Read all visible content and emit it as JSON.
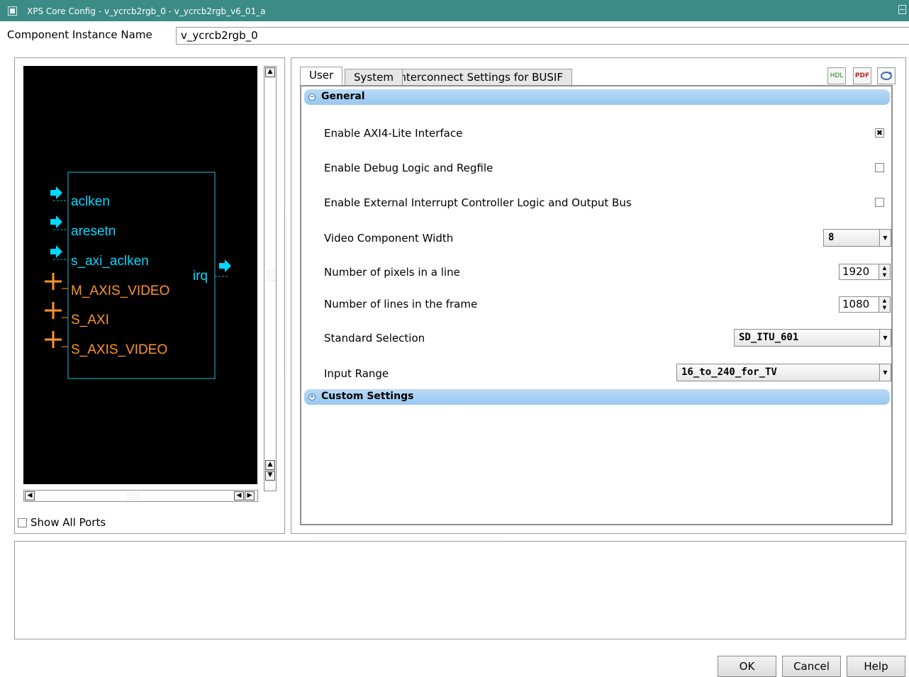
{
  "window": {
    "title": "XPS Core Config - v_ycrcb2rgb_0 - v_ycrcb2rgb_v6_01_a"
  },
  "instance": {
    "label": "Component Instance Name",
    "value": "v_ycrcb2rgb_0"
  },
  "diagram": {
    "inputs": [
      "aclken",
      "aresetn",
      "s_axi_aclken"
    ],
    "buses": [
      "M_AXIS_VIDEO",
      "S_AXI",
      "S_AXIS_VIDEO"
    ],
    "outputs": [
      "irq"
    ],
    "colors": {
      "signal": "#00d8ff",
      "bus": "#ff9429",
      "background": "#000000"
    }
  },
  "show_all_ports": {
    "label": "Show All Ports",
    "checked": false
  },
  "tabs": [
    {
      "label": "User",
      "active": true
    },
    {
      "label": "System",
      "active": false
    },
    {
      "label": "Interconnect Settings for BUSIF",
      "active": false
    }
  ],
  "toolbar_icons": [
    {
      "name": "hdl-icon",
      "text": "HDL"
    },
    {
      "name": "pdf-icon",
      "text": "PDF"
    },
    {
      "name": "refresh-icon",
      "text": ""
    }
  ],
  "sections": {
    "general": {
      "label": "General",
      "expanded": true
    },
    "custom": {
      "label": "Custom Settings",
      "expanded": false
    }
  },
  "params": {
    "axi4_lite": {
      "label": "Enable AXI4-Lite Interface",
      "checked": true
    },
    "debug": {
      "label": "Enable Debug Logic and Regfile",
      "checked": false
    },
    "ext_irq": {
      "label": "Enable External Interrupt Controller Logic and Output Bus",
      "checked": false
    },
    "comp_width": {
      "label": "Video Component Width",
      "value": "8"
    },
    "pixels": {
      "label": "Number of pixels in a line",
      "value": "1920"
    },
    "lines": {
      "label": "Number of lines in the frame",
      "value": "1080"
    },
    "standard": {
      "label": "Standard Selection",
      "value": "SD_ITU_601"
    },
    "range": {
      "label": "Input Range",
      "value": "16_to_240_for_TV"
    }
  },
  "buttons": {
    "ok": "OK",
    "cancel": "Cancel",
    "help": "Help"
  }
}
